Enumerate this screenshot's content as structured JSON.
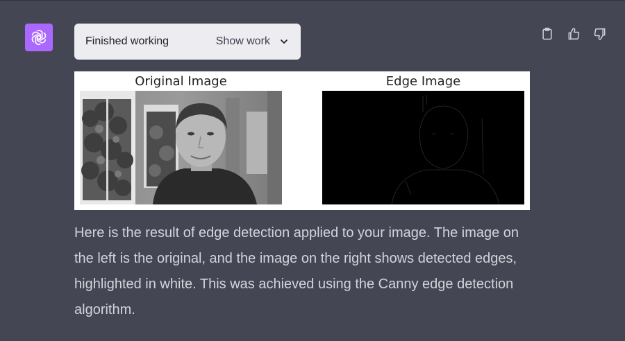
{
  "work_status": {
    "label": "Finished working",
    "toggle_label": "Show work"
  },
  "figure": {
    "left_title": "Original Image",
    "right_title": "Edge Image"
  },
  "message": {
    "text": "Here is the result of edge detection applied to your image. The image on the left is the original, and the image on the right shows detected edges, highlighted in white. This was achieved using the Canny edge detection algorithm."
  },
  "icons": {
    "avatar": "openai-logo-icon",
    "copy": "clipboard-icon",
    "like": "thumbs-up-icon",
    "dislike": "thumbs-down-icon",
    "toggle": "chevron-down-icon"
  },
  "colors": {
    "background": "#444654",
    "avatar": "#ab68ff",
    "pill": "#ececf1",
    "text": "#d1d5db"
  }
}
